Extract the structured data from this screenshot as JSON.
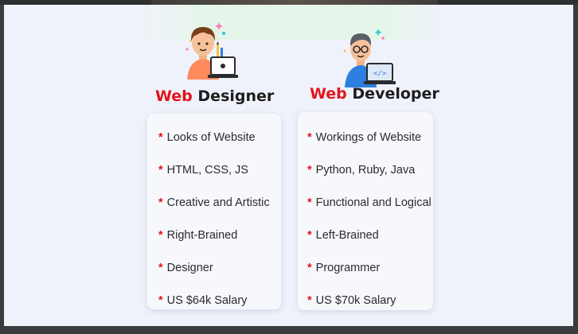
{
  "colors": {
    "accent": "#e3141b",
    "text": "#1d1d1f",
    "background": "#f0f2fb"
  },
  "designer": {
    "title_accent": "Web",
    "title_rest": "Designer",
    "avatar_icon": "designer-avatar-icon",
    "items": [
      "Looks of Website",
      "HTML, CSS, JS",
      "Creative and Artistic",
      "Right-Brained",
      "Designer",
      "US $64k Salary"
    ]
  },
  "developer": {
    "title_accent": "Web",
    "title_rest": "Developer",
    "avatar_icon": "developer-avatar-icon",
    "items": [
      "Workings of Website",
      "Python, Ruby, Java",
      "Functional and Logical",
      "Left-Brained",
      "Programmer",
      "US $70k Salary"
    ]
  },
  "bullet": "*"
}
